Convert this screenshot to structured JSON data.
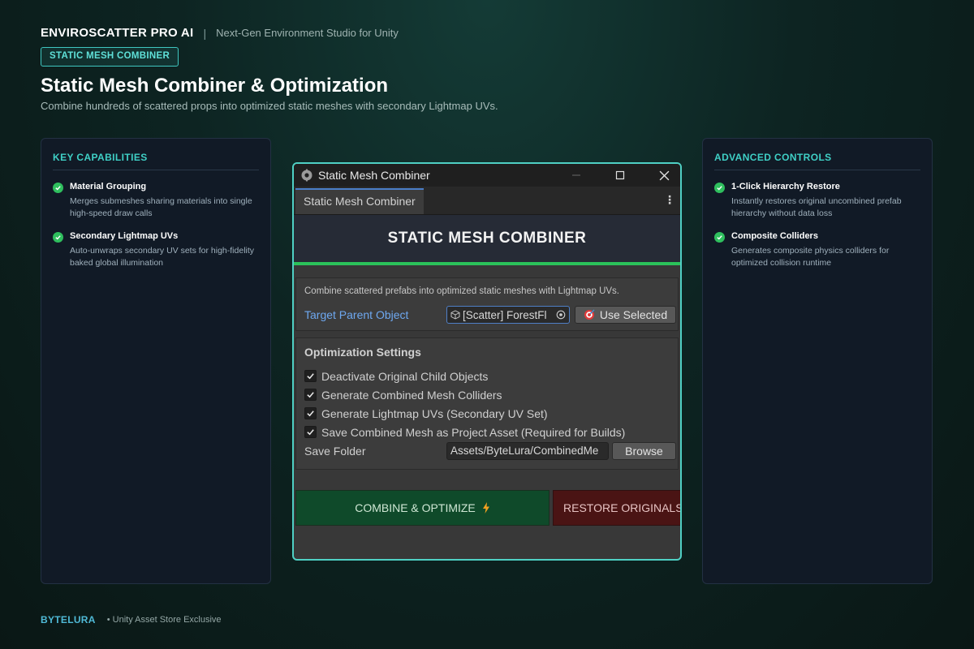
{
  "brand": {
    "name": "ENVIROSCATTER PRO AI",
    "separator": "|",
    "tagline": "Next-Gen Environment Studio for Unity"
  },
  "badge": "STATIC MESH COMBINER",
  "page": {
    "title": "Static Mesh Combiner & Optimization",
    "subtitle": "Combine hundreds of scattered props into optimized static meshes with secondary Lightmap UVs."
  },
  "left_panel": {
    "heading": "KEY CAPABILITIES",
    "features": [
      {
        "title": "Material Grouping",
        "desc_line1": "Merges submeshes sharing materials into single",
        "desc_line2": "high-speed draw calls"
      },
      {
        "title": "Secondary Lightmap UVs",
        "desc_line1": "Auto-unwraps secondary UV sets for high-fidelity",
        "desc_line2": "baked global illumination"
      }
    ]
  },
  "right_panel": {
    "heading": "ADVANCED CONTROLS",
    "features": [
      {
        "title": "1-Click Hierarchy Restore",
        "desc_line1": "Instantly restores original uncombined prefab",
        "desc_line2": "hierarchy without data loss"
      },
      {
        "title": "Composite Colliders",
        "desc_line1": "Generates composite physics colliders for",
        "desc_line2": "optimized collision runtime"
      }
    ]
  },
  "window": {
    "title": "Static Mesh Combiner",
    "tab_label": "Static Mesh Combiner",
    "banner": "STATIC MESH COMBINER",
    "description": "Combine scattered prefabs into optimized static meshes with Lightmap UVs.",
    "target_label": "Target Parent Object",
    "target_value": "[Scatter] ForestFl",
    "use_selected_label": "Use Selected",
    "settings_title": "Optimization Settings",
    "options": [
      {
        "label": "Deactivate Original Child Objects",
        "checked": true
      },
      {
        "label": "Generate Combined Mesh Colliders",
        "checked": true
      },
      {
        "label": "Generate Lightmap UVs (Secondary UV Set)",
        "checked": true
      },
      {
        "label": "Save Combined Mesh as Project Asset (Required for Builds)",
        "checked": true
      }
    ],
    "save_folder_label": "Save Folder",
    "save_folder_value": "Assets/ByteLura/CombinedMe",
    "browse_label": "Browse",
    "combine_label": "COMBINE & OPTIMIZE",
    "restore_label": "RESTORE ORIGINALS"
  },
  "footer": {
    "brand": "BYTELURA",
    "note": "• Unity Asset Store Exclusive"
  },
  "icons": {
    "check": "check-circle-icon",
    "lightning": "lightning-icon",
    "cube": "cube-icon",
    "target": "target-icon"
  },
  "colors": {
    "accent_teal": "#3fd0c6",
    "success_green": "#2bc25a",
    "combine_bg": "#0f4a2a",
    "restore_bg": "#4a1414",
    "link_blue": "#6ea8f0"
  }
}
